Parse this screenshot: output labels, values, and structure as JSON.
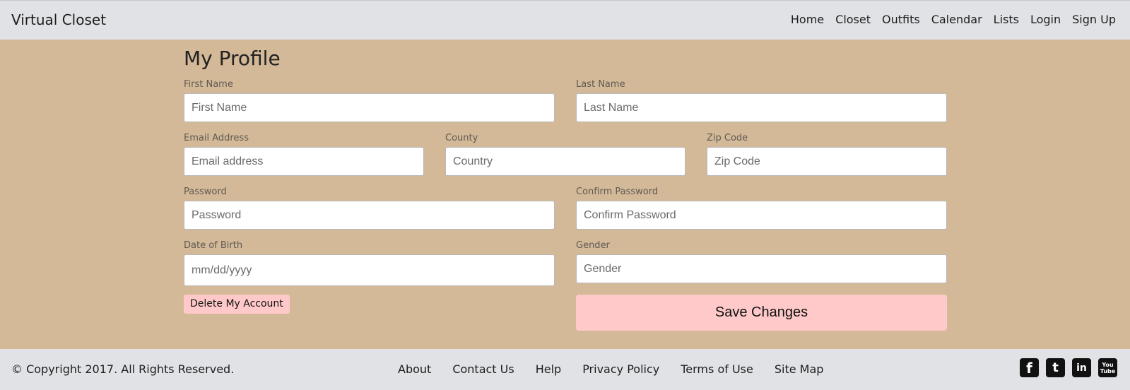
{
  "navbar": {
    "brand": "Virtual Closet",
    "links": [
      "Home",
      "Closet",
      "Outfits",
      "Calendar",
      "Lists",
      "Login",
      "Sign Up"
    ]
  },
  "profile": {
    "title": "My Profile",
    "fields": {
      "first_name": {
        "label": "First Name",
        "placeholder": "First Name"
      },
      "last_name": {
        "label": "Last Name",
        "placeholder": "Last Name"
      },
      "email": {
        "label": "Email Address",
        "placeholder": "Email address"
      },
      "country": {
        "label": "County",
        "placeholder": "Country"
      },
      "zip": {
        "label": "Zip Code",
        "placeholder": "Zip Code"
      },
      "password": {
        "label": "Password",
        "placeholder": "Password"
      },
      "confirm_password": {
        "label": "Confirm Password",
        "placeholder": "Confirm Password"
      },
      "dob": {
        "label": "Date of Birth",
        "placeholder": "mm/dd/yyyy"
      },
      "gender": {
        "label": "Gender",
        "placeholder": "Gender"
      }
    },
    "delete_label": "Delete My Account",
    "save_label": "Save Changes"
  },
  "footer": {
    "copyright": "© Copyright 2017. All Rights Reserved.",
    "links": [
      "About",
      "Contact Us",
      "Help",
      "Privacy Policy",
      "Terms of Use",
      "Site Map"
    ],
    "social": [
      {
        "icon": "facebook-icon",
        "glyph": "f"
      },
      {
        "icon": "twitter-icon",
        "glyph": "t"
      },
      {
        "icon": "linkedin-icon",
        "glyph": "in"
      },
      {
        "icon": "youtube-icon",
        "glyph": "You Tube"
      }
    ]
  },
  "colors": {
    "background": "#d3b997",
    "bars": "#e1e2e6",
    "button": "#ffc9c9"
  }
}
